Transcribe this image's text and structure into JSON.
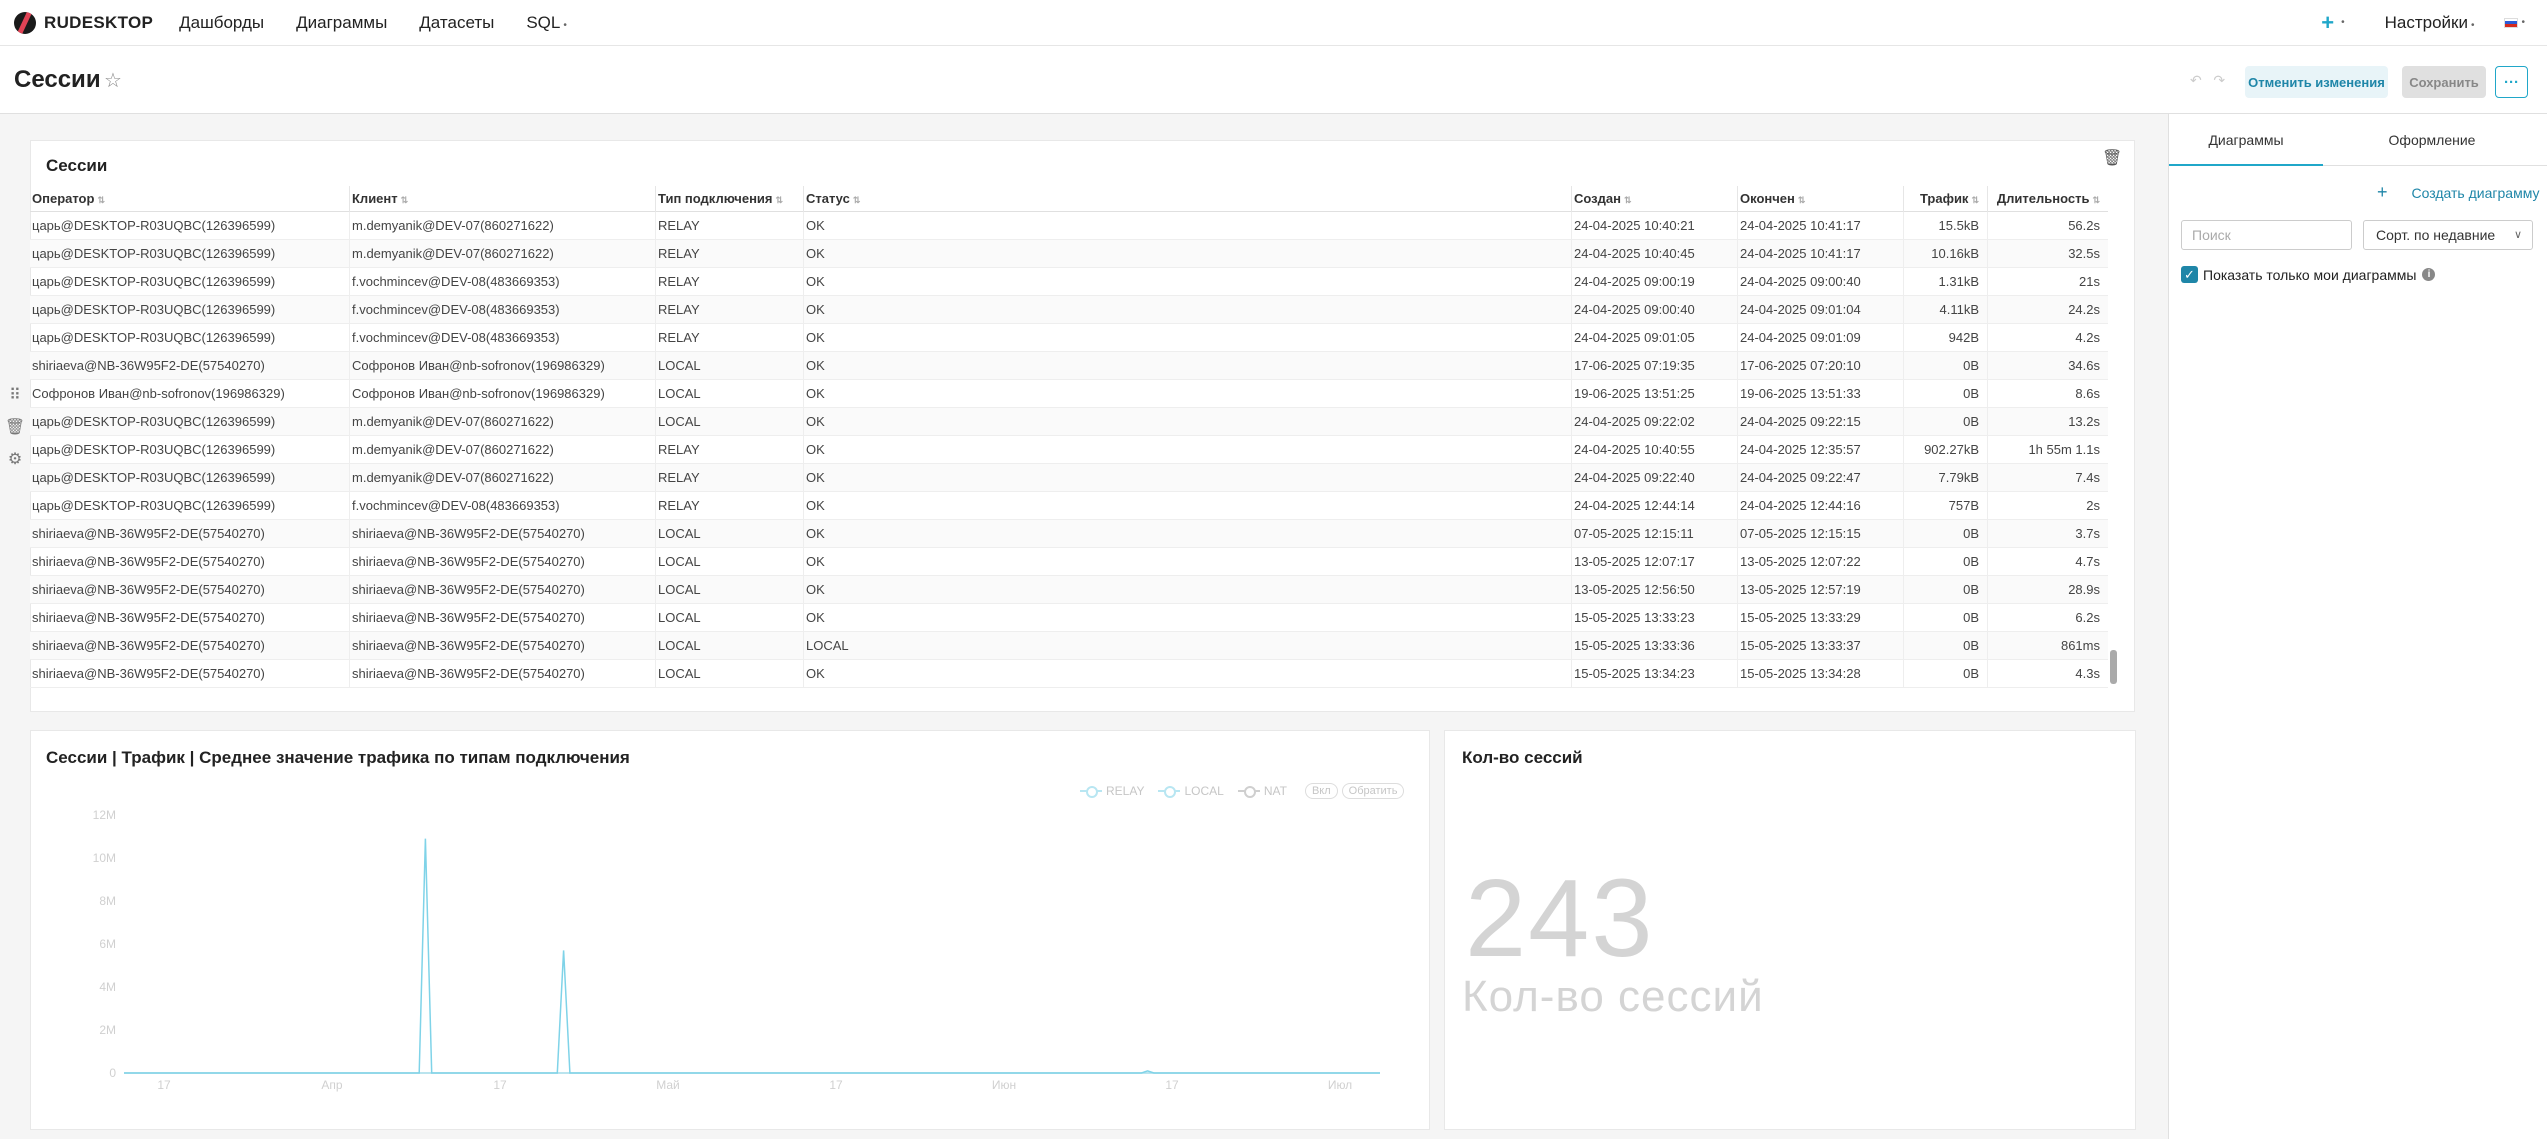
{
  "app": {
    "brand": "RUDESKTOP"
  },
  "nav": {
    "items": [
      "Дашборды",
      "Диаграммы",
      "Датасеты",
      "SQL"
    ],
    "settings": "Настройки"
  },
  "page": {
    "title": "Сессии",
    "discard_label": "Отменить изменения",
    "save_label": "Сохранить",
    "more_label": "···"
  },
  "table_card": {
    "title": "Сессии",
    "columns": [
      "Оператор",
      "Клиент",
      "Тип подключения",
      "Статус",
      "Создан",
      "Окончен",
      "Трафик",
      "Длительность"
    ],
    "rows": [
      [
        "царь@DESKTOP-R03UQBC(126396599)",
        "m.demyanik@DEV-07(860271622)",
        "RELAY",
        "OK",
        "24-04-2025 10:40:21",
        "24-04-2025 10:41:17",
        "15.5kB",
        "56.2s"
      ],
      [
        "царь@DESKTOP-R03UQBC(126396599)",
        "m.demyanik@DEV-07(860271622)",
        "RELAY",
        "OK",
        "24-04-2025 10:40:45",
        "24-04-2025 10:41:17",
        "10.16kB",
        "32.5s"
      ],
      [
        "царь@DESKTOP-R03UQBC(126396599)",
        "f.vochmincev@DEV-08(483669353)",
        "RELAY",
        "OK",
        "24-04-2025 09:00:19",
        "24-04-2025 09:00:40",
        "1.31kB",
        "21s"
      ],
      [
        "царь@DESKTOP-R03UQBC(126396599)",
        "f.vochmincev@DEV-08(483669353)",
        "RELAY",
        "OK",
        "24-04-2025 09:00:40",
        "24-04-2025 09:01:04",
        "4.11kB",
        "24.2s"
      ],
      [
        "царь@DESKTOP-R03UQBC(126396599)",
        "f.vochmincev@DEV-08(483669353)",
        "RELAY",
        "OK",
        "24-04-2025 09:01:05",
        "24-04-2025 09:01:09",
        "942B",
        "4.2s"
      ],
      [
        "shiriaeva@NB-36W95F2-DE(57540270)",
        "Софронов Иван@nb-sofronov(196986329)",
        "LOCAL",
        "OK",
        "17-06-2025 07:19:35",
        "17-06-2025 07:20:10",
        "0B",
        "34.6s"
      ],
      [
        "Софронов Иван@nb-sofronov(196986329)",
        "Софронов Иван@nb-sofronov(196986329)",
        "LOCAL",
        "OK",
        "19-06-2025 13:51:25",
        "19-06-2025 13:51:33",
        "0B",
        "8.6s"
      ],
      [
        "царь@DESKTOP-R03UQBC(126396599)",
        "m.demyanik@DEV-07(860271622)",
        "LOCAL",
        "OK",
        "24-04-2025 09:22:02",
        "24-04-2025 09:22:15",
        "0B",
        "13.2s"
      ],
      [
        "царь@DESKTOP-R03UQBC(126396599)",
        "m.demyanik@DEV-07(860271622)",
        "RELAY",
        "OK",
        "24-04-2025 10:40:55",
        "24-04-2025 12:35:57",
        "902.27kB",
        "1h 55m 1.1s"
      ],
      [
        "царь@DESKTOP-R03UQBC(126396599)",
        "m.demyanik@DEV-07(860271622)",
        "RELAY",
        "OK",
        "24-04-2025 09:22:40",
        "24-04-2025 09:22:47",
        "7.79kB",
        "7.4s"
      ],
      [
        "царь@DESKTOP-R03UQBC(126396599)",
        "f.vochmincev@DEV-08(483669353)",
        "RELAY",
        "OK",
        "24-04-2025 12:44:14",
        "24-04-2025 12:44:16",
        "757B",
        "2s"
      ],
      [
        "shiriaeva@NB-36W95F2-DE(57540270)",
        "shiriaeva@NB-36W95F2-DE(57540270)",
        "LOCAL",
        "OK",
        "07-05-2025 12:15:11",
        "07-05-2025 12:15:15",
        "0B",
        "3.7s"
      ],
      [
        "shiriaeva@NB-36W95F2-DE(57540270)",
        "shiriaeva@NB-36W95F2-DE(57540270)",
        "LOCAL",
        "OK",
        "13-05-2025 12:07:17",
        "13-05-2025 12:07:22",
        "0B",
        "4.7s"
      ],
      [
        "shiriaeva@NB-36W95F2-DE(57540270)",
        "shiriaeva@NB-36W95F2-DE(57540270)",
        "LOCAL",
        "OK",
        "13-05-2025 12:56:50",
        "13-05-2025 12:57:19",
        "0B",
        "28.9s"
      ],
      [
        "shiriaeva@NB-36W95F2-DE(57540270)",
        "shiriaeva@NB-36W95F2-DE(57540270)",
        "LOCAL",
        "OK",
        "15-05-2025 13:33:23",
        "15-05-2025 13:33:29",
        "0B",
        "6.2s"
      ],
      [
        "shiriaeva@NB-36W95F2-DE(57540270)",
        "shiriaeva@NB-36W95F2-DE(57540270)",
        "LOCAL",
        "LOCAL",
        "15-05-2025 13:33:36",
        "15-05-2025 13:33:37",
        "0B",
        "861ms"
      ],
      [
        "shiriaeva@NB-36W95F2-DE(57540270)",
        "shiriaeva@NB-36W95F2-DE(57540270)",
        "LOCAL",
        "OK",
        "15-05-2025 13:34:23",
        "15-05-2025 13:34:28",
        "0B",
        "4.3s"
      ]
    ]
  },
  "chart_card": {
    "title": "Сессии | Трафик | Среднее значение трафика по типам подключения",
    "legend_extra": [
      "Вкл",
      "Обратить"
    ]
  },
  "chart_data": {
    "type": "line",
    "title": "Сессии | Трафик | Среднее значение трафика по типам подключения",
    "y_ticks": [
      "0",
      "2M",
      "4M",
      "6M",
      "8M",
      "10M",
      "12M"
    ],
    "ylim": [
      0,
      12000000
    ],
    "x_ticks": [
      "17",
      "Апр",
      "17",
      "Май",
      "17",
      "Июн",
      "17",
      "Июл"
    ],
    "legend_placement": "top-right",
    "series": [
      {
        "name": "RELAY",
        "points": [
          [
            0.0,
            0
          ],
          [
            0.2,
            0
          ],
          [
            0.235,
            0
          ],
          [
            0.24,
            10900000
          ],
          [
            0.245,
            0
          ],
          [
            0.3,
            0
          ],
          [
            0.33,
            0
          ],
          [
            0.345,
            0
          ],
          [
            0.35,
            5700000
          ],
          [
            0.355,
            0
          ],
          [
            0.45,
            0
          ],
          [
            0.455,
            0
          ],
          [
            0.55,
            0
          ],
          [
            0.81,
            0
          ],
          [
            0.815,
            100000
          ],
          [
            0.82,
            0
          ],
          [
            1.0,
            0
          ]
        ]
      },
      {
        "name": "LOCAL",
        "points": [
          [
            0.0,
            0
          ],
          [
            1.0,
            0
          ]
        ]
      },
      {
        "name": "NAT",
        "points": [
          [
            0.0,
            0
          ],
          [
            1.0,
            0
          ]
        ]
      }
    ]
  },
  "big_number": {
    "title": "Кол-во сессий",
    "value": "243",
    "subtitle": "Кол-во сессий"
  },
  "right_panel": {
    "tabs": [
      "Диаграммы",
      "Оформление"
    ],
    "create_label": "Создать диаграмму",
    "search_placeholder": "Поиск",
    "sort_label": "Сорт. по недавние",
    "checkbox_label": "Показать только мои диаграммы"
  },
  "colors": {
    "accent": "#20a7c9",
    "chart_line": "#7fd3e8"
  }
}
